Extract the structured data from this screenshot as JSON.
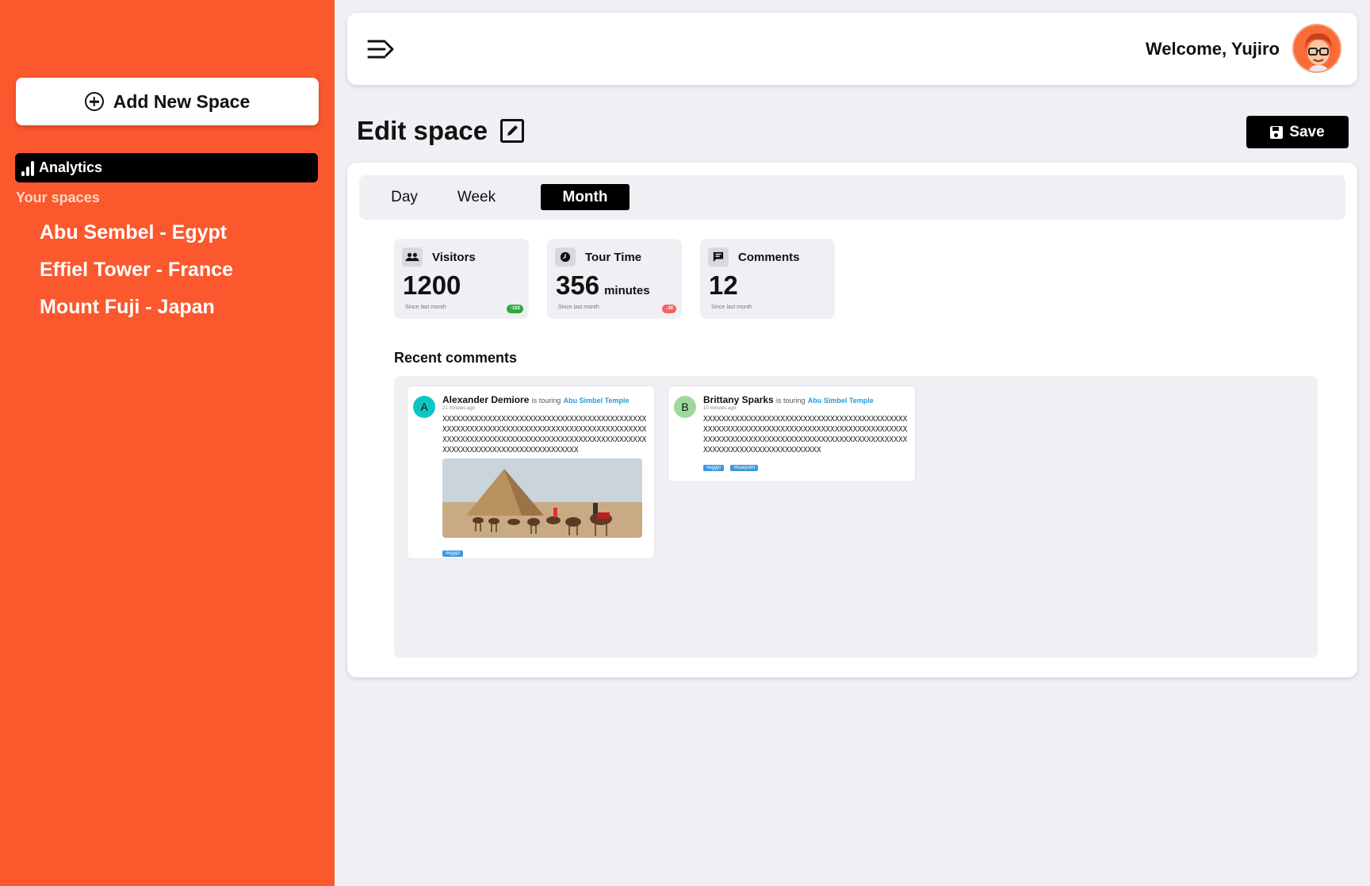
{
  "sidebar": {
    "add_button_label": "Add New Space",
    "analytics_label": "Analytics",
    "your_spaces_label": "Your spaces",
    "spaces": [
      "Abu Sembel - Egypt",
      "Effiel Tower - France",
      "Mount Fuji - Japan"
    ]
  },
  "header": {
    "welcome": "Welcome, Yujiro"
  },
  "page": {
    "title": "Edit space",
    "save_label": "Save"
  },
  "tabs": {
    "items": [
      "Day",
      "Week",
      "Month"
    ],
    "active": "Month"
  },
  "stats": [
    {
      "label": "Visitors",
      "icon": "group-icon",
      "value": "1200",
      "unit": "",
      "since": "Since last month",
      "delta": "↑102",
      "delta_color": "#2eaa3a"
    },
    {
      "label": "Tour Time",
      "icon": "clock-icon",
      "value": "356",
      "unit": "minutes",
      "since": "Since last month",
      "delta": "↓30",
      "delta_color": "#f26363"
    },
    {
      "label": "Comments",
      "icon": "comment-icon",
      "value": "12",
      "unit": "",
      "since": "Since last month",
      "delta": "",
      "delta_color": ""
    }
  ],
  "recent_comments": {
    "title": "Recent comments",
    "items": [
      {
        "avatar_letter": "A",
        "avatar_color": "#10c4c4",
        "name": "Alexander Demiore",
        "touring_text": "is touring",
        "place": "Abu Simbel Temple",
        "time": "21 minutes ago",
        "body": "XXXXXXXXXXXXXXXXXXXXXXXXXXXXXXXXXXXXXXXXXXXXXXXXXXXXXXXXXXXXXXXXXXXXXXXXXXXXXXXXXXXXXXXXXXXXXXXXXXXXXXXXXXXXXXXXXXXXXXXXXXXXXXXXXXXXXXXXXXXXXXXXXXXXXXXXXXXXXXXXXXXXX",
        "has_photo": true,
        "tags": [
          "#egypt"
        ]
      },
      {
        "avatar_letter": "B",
        "avatar_color": "#9fd89c",
        "name": "Brittany Sparks",
        "touring_text": "is touring",
        "place": "Abu Simbel Temple",
        "time": "10 minutes ago",
        "body": "XXXXXXXXXXXXXXXXXXXXXXXXXXXXXXXXXXXXXXXXXXXXXXXXXXXXXXXXXXXXXXXXXXXXXXXXXXXXXXXXXXXXXXXXXXXXXXXXXXXXXXXXXXXXXXXXXXXXXXXXXXXXXXXXXXXXXXXXXXXXXXXXXXXXXXXXXXXXXXXXX",
        "has_photo": false,
        "tags": [
          "#egypt",
          "#tourpoint"
        ]
      }
    ]
  },
  "colors": {
    "sidebar_bg": "#fb582e",
    "page_bg": "#efeff4",
    "accent_dark": "#000000",
    "link_blue": "#2a9ad8",
    "tag_blue": "#3c98df"
  }
}
